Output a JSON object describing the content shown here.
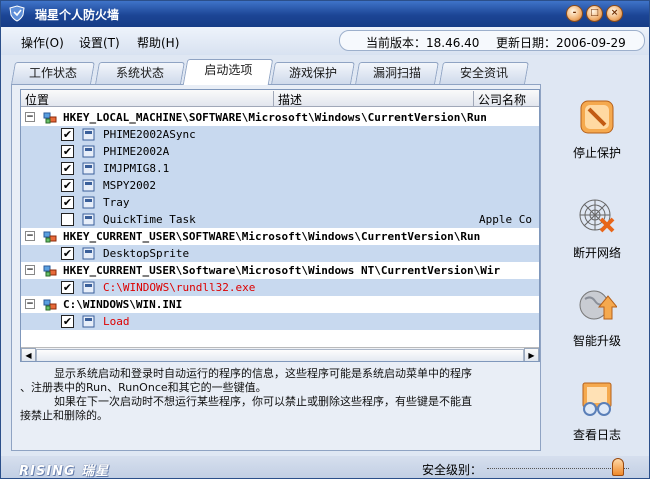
{
  "window": {
    "title": "瑞星个人防火墙",
    "controls": [
      "-",
      "□",
      "×"
    ]
  },
  "menu": {
    "items": [
      "操作(O)",
      "设置(T)",
      "帮助(H)"
    ]
  },
  "version": {
    "current_label": "当前版本：18.46.40",
    "update_label": "更新日期：2006-09-29"
  },
  "tabs": [
    "工作状态",
    "系统状态",
    "启动选项",
    "游戏保护",
    "漏洞扫描",
    "安全资讯"
  ],
  "active_tab": "启动选项",
  "list": {
    "columns": [
      "位置",
      "描述",
      "公司名称"
    ],
    "rows": [
      {
        "kind": "group",
        "text": "HKEY_LOCAL_MACHINE\\SOFTWARE\\Microsoft\\Windows\\CurrentVersion\\Run",
        "expander": "−"
      },
      {
        "kind": "item",
        "text": "PHIME2002ASync",
        "checked": true,
        "red": false,
        "company": ""
      },
      {
        "kind": "item",
        "text": "PHIME2002A",
        "checked": true,
        "red": false,
        "company": ""
      },
      {
        "kind": "item",
        "text": "IMJPMIG8.1",
        "checked": true,
        "red": false,
        "company": ""
      },
      {
        "kind": "item",
        "text": "MSPY2002",
        "checked": true,
        "red": false,
        "company": ""
      },
      {
        "kind": "item",
        "text": "Tray",
        "checked": true,
        "red": false,
        "company": ""
      },
      {
        "kind": "item",
        "text": "QuickTime Task",
        "checked": false,
        "red": false,
        "company": "Apple Co"
      },
      {
        "kind": "group",
        "text": "HKEY_CURRENT_USER\\SOFTWARE\\Microsoft\\Windows\\CurrentVersion\\Run",
        "expander": "−"
      },
      {
        "kind": "item",
        "text": "DesktopSprite",
        "checked": true,
        "red": false,
        "company": ""
      },
      {
        "kind": "group",
        "text": "HKEY_CURRENT_USER\\Software\\Microsoft\\Windows NT\\CurrentVersion\\Wir",
        "expander": "−"
      },
      {
        "kind": "item",
        "text": "C:\\WINDOWS\\rundll32.exe",
        "checked": true,
        "red": true,
        "company": ""
      },
      {
        "kind": "group",
        "text": "C:\\WINDOWS\\WIN.INI",
        "expander": "−"
      },
      {
        "kind": "item",
        "text": "Load",
        "checked": true,
        "red": true,
        "company": ""
      }
    ]
  },
  "description": {
    "line1": "显示系统启动和登录时自动运行的程序的信息，这些程序可能是系统启动菜单中的程序",
    "line2": "、注册表中的Run、RunOnce和其它的一些键值。",
    "line3": "如果在下一次启动时不想运行某些程序，你可以禁止或删除这些程序，有些键是不能直",
    "line4": "接禁止和删除的。"
  },
  "side_buttons": [
    "停止保护",
    "断开网络",
    "智能升级",
    "查看日志"
  ],
  "status": {
    "logo": "RISING 瑞星",
    "security_level_label": "安全级别：",
    "security_level": 1.0
  },
  "colors": {
    "title_bg": "#1c4595",
    "selected_row": "#c8d9ef",
    "red_text": "#dd0000",
    "accent_orange": "#f08a2a"
  }
}
